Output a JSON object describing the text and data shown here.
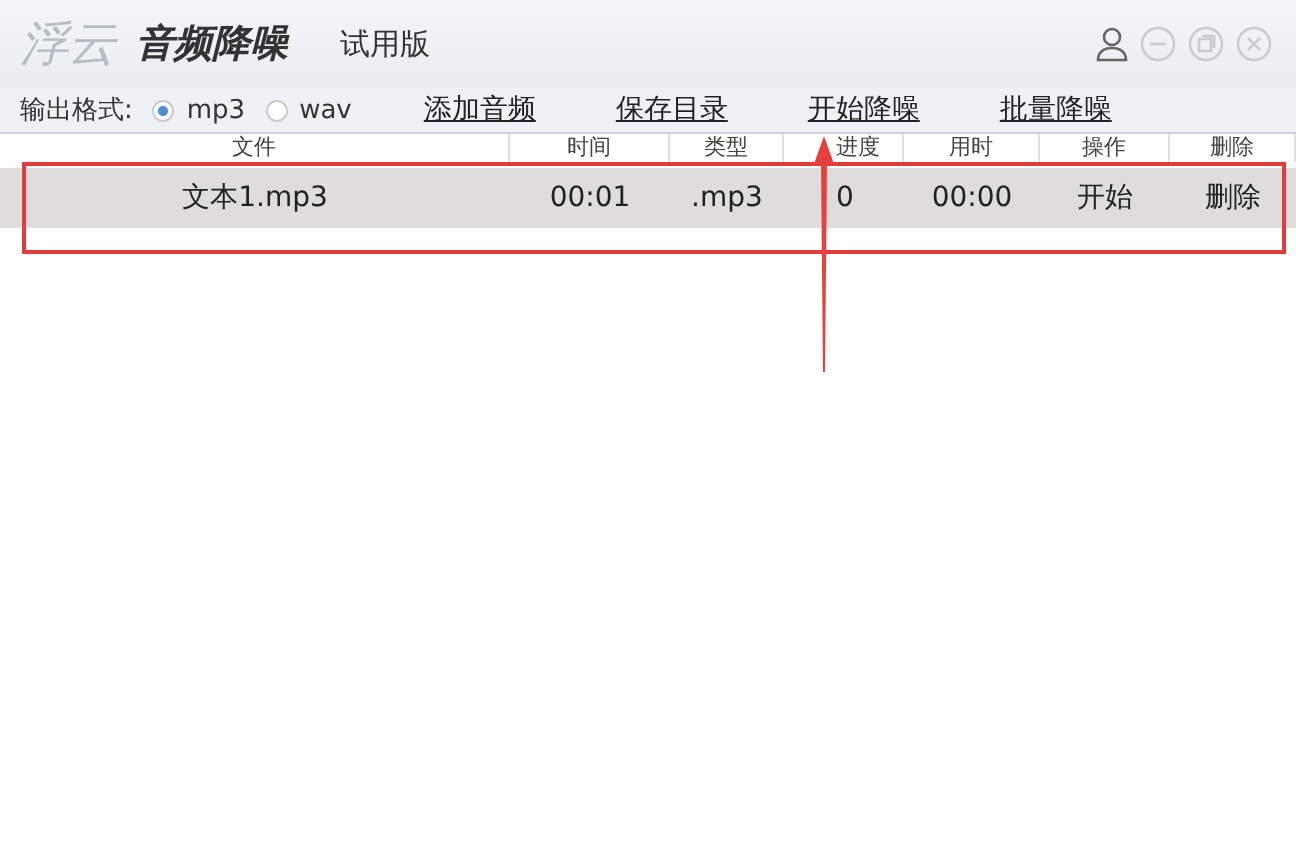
{
  "window": {
    "logo": "浮云",
    "title": "音频降噪",
    "edition": "试用版"
  },
  "toolbar": {
    "format_label": "输出格式:",
    "formats": [
      {
        "label": "mp3",
        "selected": true
      },
      {
        "label": "wav",
        "selected": false
      }
    ],
    "links": [
      "添加音频",
      "保存目录",
      "开始降噪",
      "批量降噪"
    ]
  },
  "table": {
    "columns": [
      "文件",
      "时间",
      "类型",
      "进度",
      "用时",
      "操作",
      "删除"
    ],
    "rows": [
      {
        "cells": [
          "文本1.mp3",
          "00:01",
          ".mp3",
          "0",
          "00:00",
          "开始",
          "删除"
        ],
        "selected": true
      }
    ]
  }
}
